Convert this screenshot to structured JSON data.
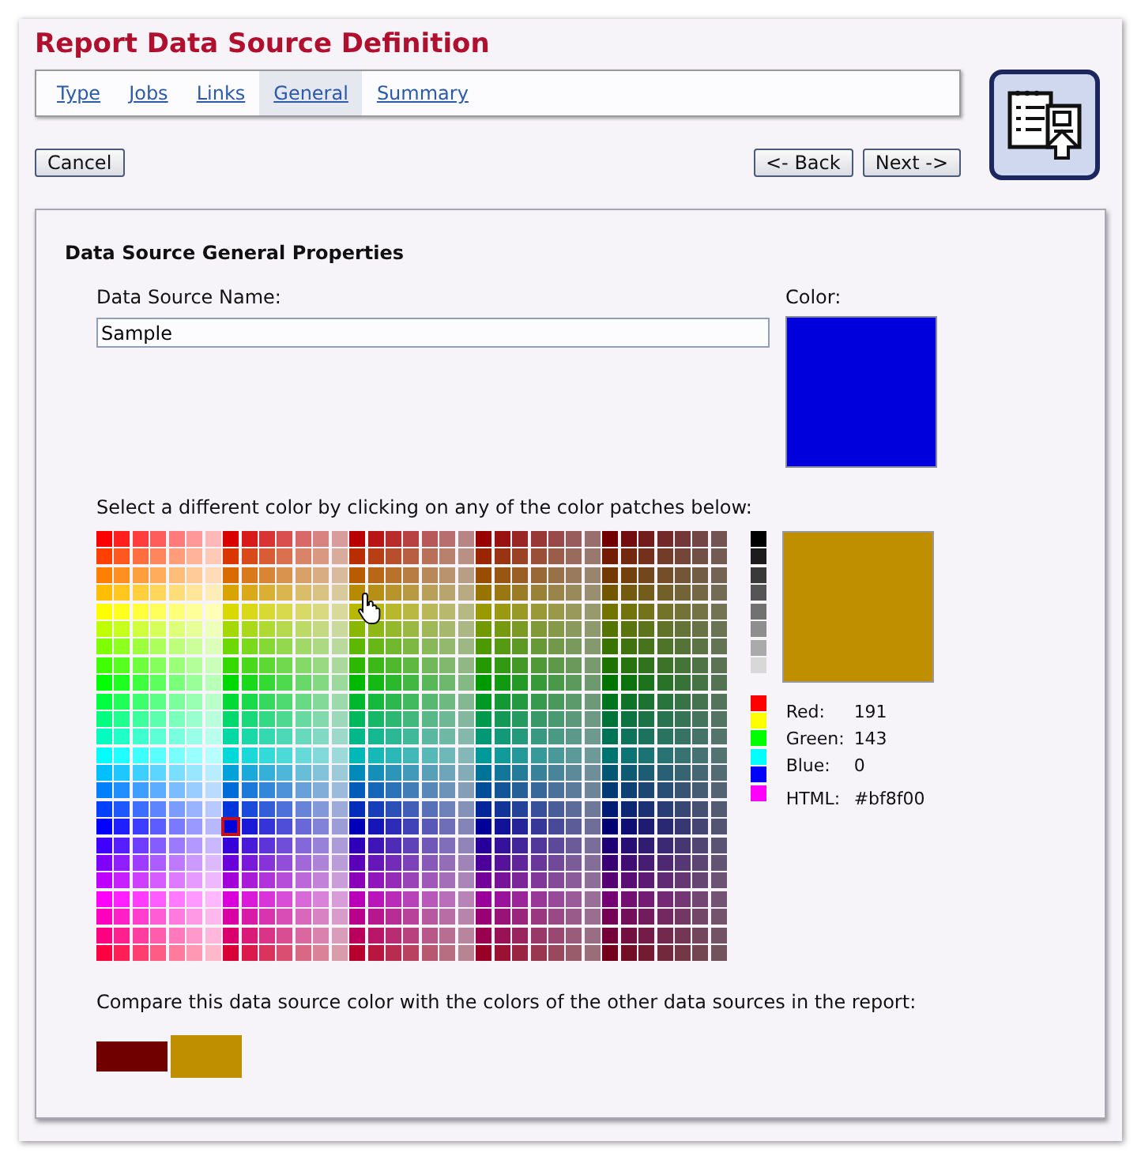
{
  "title": "Report Data Source Definition",
  "tabs": [
    {
      "label": "Type",
      "selected": false
    },
    {
      "label": "Jobs",
      "selected": false
    },
    {
      "label": "Links",
      "selected": false
    },
    {
      "label": "General",
      "selected": true
    },
    {
      "label": "Summary",
      "selected": false
    }
  ],
  "buttons": {
    "cancel": "Cancel",
    "back": "<- Back",
    "next": "Next ->"
  },
  "section_title": "Data Source General Properties",
  "name_field": {
    "label": "Data Source Name:",
    "value": "Sample"
  },
  "color_field": {
    "label": "Color:",
    "color": "#0000dd"
  },
  "palette_prompt": "Select a different color by clicking on any of the color patches below:",
  "palette": {
    "rows": [
      {
        "selected": false
      },
      {
        "selected": false
      },
      {
        "selected": false
      },
      {
        "selected": false
      },
      {
        "selected": false
      },
      {
        "selected": false
      },
      {
        "selected": false
      },
      {
        "selected": false
      },
      {
        "selected": false
      },
      {
        "selected": false
      },
      {
        "selected": false
      },
      {
        "selected": false
      },
      {
        "selected": false
      },
      {
        "selected": false
      },
      {
        "selected": false
      },
      {
        "selected": false
      },
      {
        "selected": true
      },
      {
        "selected": false
      },
      {
        "selected": false
      },
      {
        "selected": false
      },
      {
        "selected": false
      },
      {
        "selected": false
      },
      {
        "selected": false
      },
      {
        "selected": false
      }
    ],
    "columns": [
      {
        "selected": false
      },
      {
        "selected": false
      },
      {
        "selected": false
      },
      {
        "selected": false
      },
      {
        "selected": false
      },
      {
        "selected": false
      },
      {
        "selected": false
      },
      {
        "selected": true
      },
      {
        "selected": false
      },
      {
        "selected": false
      },
      {
        "selected": false
      },
      {
        "selected": false
      },
      {
        "selected": false
      },
      {
        "selected": false
      },
      {
        "selected": false
      },
      {
        "selected": false
      },
      {
        "selected": false
      },
      {
        "selected": false
      },
      {
        "selected": false
      },
      {
        "selected": false
      },
      {
        "selected": false
      },
      {
        "selected": false
      },
      {
        "selected": false
      },
      {
        "selected": false
      },
      {
        "selected": false
      },
      {
        "selected": false
      },
      {
        "selected": false
      },
      {
        "selected": false
      },
      {
        "selected": false
      },
      {
        "selected": false
      },
      {
        "selected": false
      },
      {
        "selected": false
      },
      {
        "selected": false
      },
      {
        "selected": false
      },
      {
        "selected": false
      }
    ]
  },
  "grays": [
    {
      "color": "#000000"
    },
    {
      "color": "#1c1c1c"
    },
    {
      "color": "#393939"
    },
    {
      "color": "#555555"
    },
    {
      "color": "#717171"
    },
    {
      "color": "#8e8e8e"
    },
    {
      "color": "#aaaaaa"
    },
    {
      "color": "#d8d8d8"
    }
  ],
  "primaries": [
    {
      "color": "#ff0000"
    },
    {
      "color": "#ffff00"
    },
    {
      "color": "#00ff00"
    },
    {
      "color": "#00ffff"
    },
    {
      "color": "#0000ff"
    },
    {
      "color": "#ff00ff"
    }
  ],
  "preview": {
    "color": "#bf8f00"
  },
  "rgb": [
    {
      "label": "Red:",
      "value": "191"
    },
    {
      "label": "Green:",
      "value": "143"
    },
    {
      "label": "Blue:",
      "value": "0"
    }
  ],
  "html": {
    "label": "HTML:",
    "value": "#bf8f00"
  },
  "compare_prompt": "Compare this data source color with the colors of the other data sources in the report:",
  "compare_swatches": [
    {
      "color": "#700000",
      "current": false
    },
    {
      "color": "#bf8f00",
      "current": true
    }
  ]
}
